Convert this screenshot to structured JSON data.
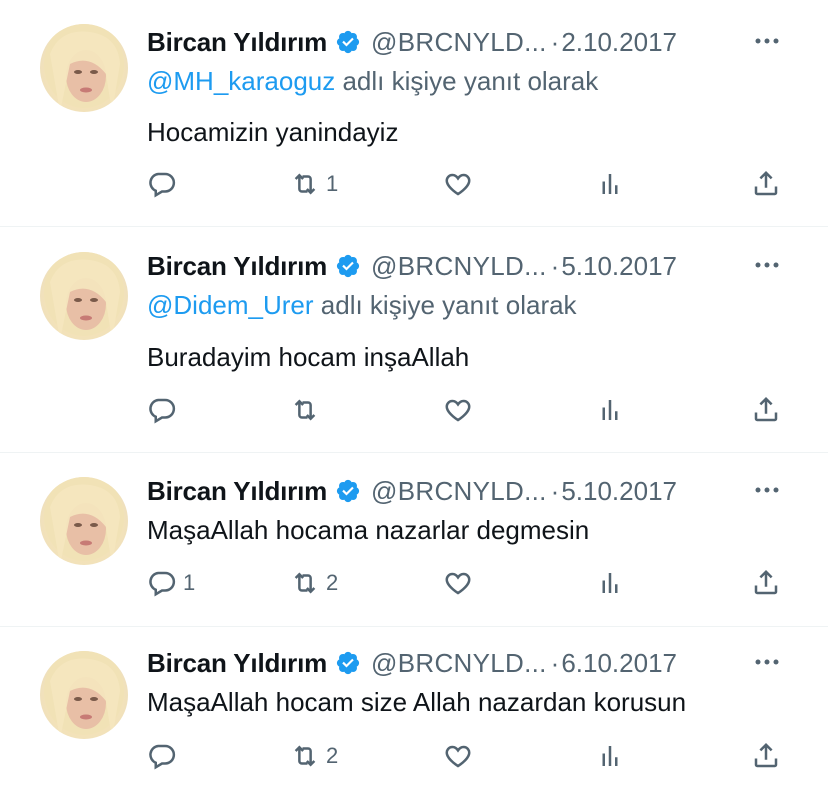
{
  "tweets": [
    {
      "name": "Bircan Yıldırım",
      "handle": "@BRCNYLD...",
      "separator": "·",
      "date": "2.10.2017",
      "reply_mention": "@MH_karaoguz",
      "reply_suffix": " adlı kişiye yanıt olarak",
      "text": "Hocamizin yanindayiz",
      "reply_count": "",
      "retweet_count": "1"
    },
    {
      "name": "Bircan Yıldırım",
      "handle": "@BRCNYLD...",
      "separator": "·",
      "date": "5.10.2017",
      "reply_mention": "@Didem_Urer",
      "reply_suffix": " adlı kişiye yanıt olarak",
      "text": "Buradayim hocam inşaAllah",
      "reply_count": "",
      "retweet_count": ""
    },
    {
      "name": "Bircan Yıldırım",
      "handle": "@BRCNYLD...",
      "separator": "·",
      "date": "5.10.2017",
      "text": "MaşaAllah hocama nazarlar degmesin",
      "reply_count": "1",
      "retweet_count": "2"
    },
    {
      "name": "Bircan Yıldırım",
      "handle": "@BRCNYLD...",
      "separator": "·",
      "date": "6.10.2017",
      "text": "MaşaAllah hocam size Allah nazardan korusun",
      "reply_count": "",
      "retweet_count": "2"
    }
  ],
  "icons": {
    "reply": "reply-icon",
    "retweet": "retweet-icon",
    "like": "heart-icon",
    "views": "views-icon",
    "share": "share-icon",
    "more": "more-icon",
    "verified": "verified-badge-icon"
  },
  "colors": {
    "text": "#0f1419",
    "secondary": "#536471",
    "link": "#1d9bf0",
    "verified": "#1d9bf0",
    "divider": "#eff3f4"
  }
}
